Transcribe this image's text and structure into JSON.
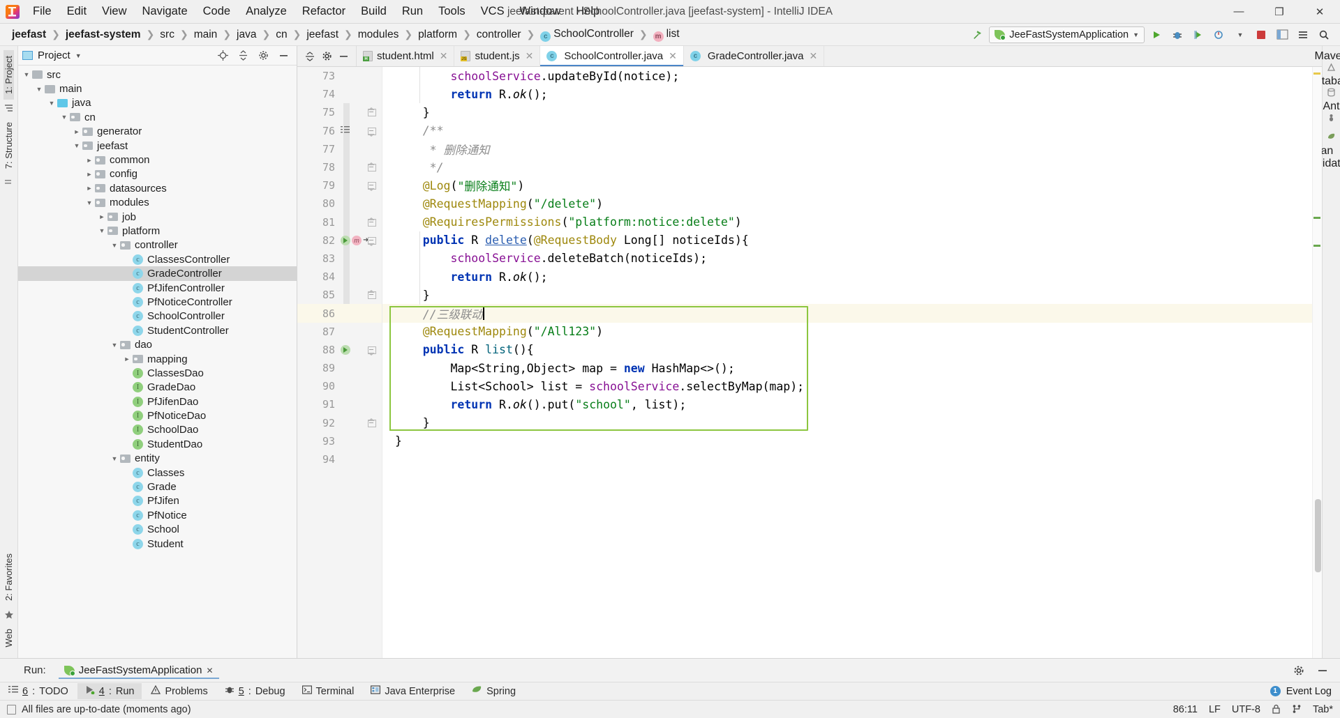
{
  "window": {
    "title": "jeefast-parent - SchoolController.java [jeefast-system] - IntelliJ IDEA",
    "minimize": "—",
    "maximize": "❐",
    "close": "✕"
  },
  "menu": [
    {
      "label": "File"
    },
    {
      "label": "Edit"
    },
    {
      "label": "View"
    },
    {
      "label": "Navigate"
    },
    {
      "label": "Code"
    },
    {
      "label": "Analyze"
    },
    {
      "label": "Refactor"
    },
    {
      "label": "Build"
    },
    {
      "label": "Run"
    },
    {
      "label": "Tools"
    },
    {
      "label": "VCS"
    },
    {
      "label": "Window"
    },
    {
      "label": "Help"
    }
  ],
  "breadcrumb": [
    {
      "label": "jeefast",
      "bold": true,
      "icon": null
    },
    {
      "label": "jeefast-system",
      "bold": true,
      "icon": null
    },
    {
      "label": "src",
      "bold": false,
      "icon": null
    },
    {
      "label": "main",
      "bold": false,
      "icon": null
    },
    {
      "label": "java",
      "bold": false,
      "icon": null
    },
    {
      "label": "cn",
      "bold": false,
      "icon": null
    },
    {
      "label": "jeefast",
      "bold": false,
      "icon": null
    },
    {
      "label": "modules",
      "bold": false,
      "icon": null
    },
    {
      "label": "platform",
      "bold": false,
      "icon": null
    },
    {
      "label": "controller",
      "bold": false,
      "icon": null
    },
    {
      "label": "SchoolController",
      "bold": false,
      "icon": "class"
    },
    {
      "label": "list",
      "bold": false,
      "icon": "method"
    }
  ],
  "toolbar": {
    "run_config": "JeeFastSystemApplication",
    "build_icon": "hammer-icon",
    "run_icon": "run-icon",
    "debug_icon": "debug-icon",
    "coverage_icon": "coverage-icon",
    "profile_icon": "profile-icon",
    "stop_icon": "stop-icon",
    "layout_icon": "layout-icon",
    "settings_icon": "settings-icon",
    "search_icon": "search-icon"
  },
  "left_rail": [
    "1: Project",
    "7: Structure",
    "2: Favorites",
    "Web"
  ],
  "right_rail": [
    "Maven",
    "Database",
    "Ant",
    "Bean Validation"
  ],
  "project_panel": {
    "title": "Project",
    "locate_icon": "locate-icon",
    "collapse_icon": "collapse-all-icon",
    "settings_icon": "gear-icon",
    "hide_icon": "hide-icon",
    "tree": [
      {
        "label": "src",
        "depth": 1,
        "arrow": "down",
        "type": "folder-src"
      },
      {
        "label": "main",
        "depth": 2,
        "arrow": "down",
        "type": "folder-src"
      },
      {
        "label": "java",
        "depth": 3,
        "arrow": "down",
        "type": "folder-blue"
      },
      {
        "label": "cn",
        "depth": 4,
        "arrow": "down",
        "type": "folder-pkg"
      },
      {
        "label": "generator",
        "depth": 5,
        "arrow": "right",
        "type": "folder-pkg"
      },
      {
        "label": "jeefast",
        "depth": 5,
        "arrow": "down",
        "type": "folder-pkg"
      },
      {
        "label": "common",
        "depth": 6,
        "arrow": "right",
        "type": "folder-pkg"
      },
      {
        "label": "config",
        "depth": 6,
        "arrow": "right",
        "type": "folder-pkg"
      },
      {
        "label": "datasources",
        "depth": 6,
        "arrow": "right",
        "type": "folder-pkg"
      },
      {
        "label": "modules",
        "depth": 6,
        "arrow": "down",
        "type": "folder-pkg"
      },
      {
        "label": "job",
        "depth": 7,
        "arrow": "right",
        "type": "folder-pkg"
      },
      {
        "label": "platform",
        "depth": 7,
        "arrow": "down",
        "type": "folder-pkg"
      },
      {
        "label": "controller",
        "depth": 8,
        "arrow": "down",
        "type": "folder-pkg"
      },
      {
        "label": "ClassesController",
        "depth": 9,
        "arrow": "none",
        "type": "class"
      },
      {
        "label": "GradeController",
        "depth": 9,
        "arrow": "none",
        "type": "class",
        "selected": true
      },
      {
        "label": "PfJifenController",
        "depth": 9,
        "arrow": "none",
        "type": "class"
      },
      {
        "label": "PfNoticeController",
        "depth": 9,
        "arrow": "none",
        "type": "class"
      },
      {
        "label": "SchoolController",
        "depth": 9,
        "arrow": "none",
        "type": "class"
      },
      {
        "label": "StudentController",
        "depth": 9,
        "arrow": "none",
        "type": "class"
      },
      {
        "label": "dao",
        "depth": 8,
        "arrow": "down",
        "type": "folder-pkg"
      },
      {
        "label": "mapping",
        "depth": 9,
        "arrow": "right",
        "type": "folder-pkg"
      },
      {
        "label": "ClassesDao",
        "depth": 9,
        "arrow": "none",
        "type": "interface"
      },
      {
        "label": "GradeDao",
        "depth": 9,
        "arrow": "none",
        "type": "interface"
      },
      {
        "label": "PfJifenDao",
        "depth": 9,
        "arrow": "none",
        "type": "interface"
      },
      {
        "label": "PfNoticeDao",
        "depth": 9,
        "arrow": "none",
        "type": "interface"
      },
      {
        "label": "SchoolDao",
        "depth": 9,
        "arrow": "none",
        "type": "interface"
      },
      {
        "label": "StudentDao",
        "depth": 9,
        "arrow": "none",
        "type": "interface"
      },
      {
        "label": "entity",
        "depth": 8,
        "arrow": "down",
        "type": "folder-pkg"
      },
      {
        "label": "Classes",
        "depth": 9,
        "arrow": "none",
        "type": "class"
      },
      {
        "label": "Grade",
        "depth": 9,
        "arrow": "none",
        "type": "class"
      },
      {
        "label": "PfJifen",
        "depth": 9,
        "arrow": "none",
        "type": "class"
      },
      {
        "label": "PfNotice",
        "depth": 9,
        "arrow": "none",
        "type": "class"
      },
      {
        "label": "School",
        "depth": 9,
        "arrow": "none",
        "type": "class"
      },
      {
        "label": "Student",
        "depth": 9,
        "arrow": "none",
        "type": "class"
      }
    ]
  },
  "tabs": [
    {
      "label": "student.html",
      "icon": "html-file-icon",
      "active": false
    },
    {
      "label": "student.js",
      "icon": "js-file-icon",
      "active": false
    },
    {
      "label": "SchoolController.java",
      "icon": "java-class-icon",
      "active": true
    },
    {
      "label": "GradeController.java",
      "icon": "java-class-icon",
      "active": false
    }
  ],
  "editor": {
    "first_line": 73,
    "lines": [
      {
        "n": 73,
        "segments": [
          {
            "t": "        ",
            "c": "def"
          },
          {
            "t": "schoolService",
            "c": "fld"
          },
          {
            "t": ".updateById(notice);",
            "c": "def"
          }
        ],
        "fold": null,
        "marks": []
      },
      {
        "n": 74,
        "segments": [
          {
            "t": "        ",
            "c": "def"
          },
          {
            "t": "return",
            "c": "kw"
          },
          {
            "t": " R.",
            "c": "def"
          },
          {
            "t": "ok",
            "c": "mth-i"
          },
          {
            "t": "();",
            "c": "def"
          }
        ],
        "fold": null,
        "marks": []
      },
      {
        "n": 75,
        "segments": [
          {
            "t": "    }",
            "c": "def"
          }
        ],
        "fold": "up",
        "marks": []
      },
      {
        "n": 76,
        "segments": [
          {
            "t": "    /**",
            "c": "cmt"
          }
        ],
        "fold": "down",
        "marks": [
          "javadoc"
        ]
      },
      {
        "n": 77,
        "segments": [
          {
            "t": "     * 删除通知",
            "c": "cmt"
          }
        ],
        "fold": null,
        "marks": []
      },
      {
        "n": 78,
        "segments": [
          {
            "t": "     */",
            "c": "cmt"
          }
        ],
        "fold": "up",
        "marks": []
      },
      {
        "n": 79,
        "segments": [
          {
            "t": "    ",
            "c": "def"
          },
          {
            "t": "@Log",
            "c": "ann"
          },
          {
            "t": "(",
            "c": "def"
          },
          {
            "t": "\"删除通知\"",
            "c": "str"
          },
          {
            "t": ")",
            "c": "def"
          }
        ],
        "fold": "down",
        "marks": []
      },
      {
        "n": 80,
        "segments": [
          {
            "t": "    ",
            "c": "def"
          },
          {
            "t": "@RequestMapping",
            "c": "ann"
          },
          {
            "t": "(",
            "c": "def"
          },
          {
            "t": "\"/delete\"",
            "c": "str"
          },
          {
            "t": ")",
            "c": "def"
          }
        ],
        "fold": null,
        "marks": []
      },
      {
        "n": 81,
        "segments": [
          {
            "t": "    ",
            "c": "def"
          },
          {
            "t": "@RequiresPermissions",
            "c": "ann"
          },
          {
            "t": "(",
            "c": "def"
          },
          {
            "t": "\"platform:notice:delete\"",
            "c": "str"
          },
          {
            "t": ")",
            "c": "def"
          }
        ],
        "fold": "up",
        "marks": []
      },
      {
        "n": 82,
        "segments": [
          {
            "t": "    ",
            "c": "def"
          },
          {
            "t": "public",
            "c": "kw"
          },
          {
            "t": " R ",
            "c": "def"
          },
          {
            "t": "delete",
            "c": "ul"
          },
          {
            "t": "(",
            "c": "def"
          },
          {
            "t": "@RequestBody",
            "c": "ann"
          },
          {
            "t": " Long[] noticeIds){",
            "c": "def"
          }
        ],
        "fold": "down",
        "marks": [
          "run",
          "method"
        ]
      },
      {
        "n": 83,
        "segments": [
          {
            "t": "        ",
            "c": "def"
          },
          {
            "t": "schoolService",
            "c": "fld"
          },
          {
            "t": ".deleteBatch(noticeIds);",
            "c": "def"
          }
        ],
        "fold": null,
        "marks": []
      },
      {
        "n": 84,
        "segments": [
          {
            "t": "        ",
            "c": "def"
          },
          {
            "t": "return",
            "c": "kw"
          },
          {
            "t": " R.",
            "c": "def"
          },
          {
            "t": "ok",
            "c": "mth-i"
          },
          {
            "t": "();",
            "c": "def"
          }
        ],
        "fold": null,
        "marks": []
      },
      {
        "n": 85,
        "segments": [
          {
            "t": "    }",
            "c": "def"
          }
        ],
        "fold": "up",
        "marks": []
      },
      {
        "n": 86,
        "segments": [
          {
            "t": "    //三级联动",
            "c": "cmt"
          }
        ],
        "fold": null,
        "marks": [],
        "highlight": true,
        "caret": true
      },
      {
        "n": 87,
        "segments": [
          {
            "t": "    ",
            "c": "def"
          },
          {
            "t": "@RequestMapping",
            "c": "ann"
          },
          {
            "t": "(",
            "c": "def"
          },
          {
            "t": "\"/All123\"",
            "c": "str"
          },
          {
            "t": ")",
            "c": "def"
          }
        ],
        "fold": null,
        "marks": []
      },
      {
        "n": 88,
        "segments": [
          {
            "t": "    ",
            "c": "def"
          },
          {
            "t": "public",
            "c": "kw"
          },
          {
            "t": " R ",
            "c": "def"
          },
          {
            "t": "list",
            "c": "mth"
          },
          {
            "t": "(){",
            "c": "def"
          }
        ],
        "fold": "down",
        "marks": [
          "run"
        ]
      },
      {
        "n": 89,
        "segments": [
          {
            "t": "        Map<String,Object> map = ",
            "c": "def"
          },
          {
            "t": "new",
            "c": "kw"
          },
          {
            "t": " HashMap<>();",
            "c": "def"
          }
        ],
        "fold": null,
        "marks": []
      },
      {
        "n": 90,
        "segments": [
          {
            "t": "        List<School> list = ",
            "c": "def"
          },
          {
            "t": "schoolService",
            "c": "fld"
          },
          {
            "t": ".selectByMap(map);",
            "c": "def"
          }
        ],
        "fold": null,
        "marks": []
      },
      {
        "n": 91,
        "segments": [
          {
            "t": "        ",
            "c": "def"
          },
          {
            "t": "return",
            "c": "kw"
          },
          {
            "t": " R.",
            "c": "def"
          },
          {
            "t": "ok",
            "c": "mth-i"
          },
          {
            "t": "().put(",
            "c": "def"
          },
          {
            "t": "\"school\"",
            "c": "str"
          },
          {
            "t": ", list);",
            "c": "def"
          }
        ],
        "fold": null,
        "marks": []
      },
      {
        "n": 92,
        "segments": [
          {
            "t": "    }",
            "c": "def"
          }
        ],
        "fold": "up",
        "marks": []
      },
      {
        "n": 93,
        "segments": [
          {
            "t": "}",
            "c": "def"
          }
        ],
        "fold": null,
        "marks": []
      },
      {
        "n": 94,
        "segments": [],
        "fold": null,
        "marks": []
      }
    ]
  },
  "run_panel": {
    "label": "Run:",
    "tab": "JeeFastSystemApplication",
    "close_icon": "close-icon",
    "settings_icon": "gear-icon",
    "hide_icon": "hide-icon"
  },
  "tool_windows": [
    {
      "num": "6",
      "label": "TODO",
      "icon": "todo-icon",
      "selected": false
    },
    {
      "num": "4",
      "label": "Run",
      "icon": "run-icon",
      "selected": true
    },
    {
      "num": "",
      "label": "Problems",
      "icon": "warning-icon",
      "selected": false
    },
    {
      "num": "5",
      "label": "Debug",
      "icon": "debug-icon",
      "selected": false
    },
    {
      "num": "",
      "label": "Terminal",
      "icon": "terminal-icon",
      "selected": false
    },
    {
      "num": "",
      "label": "Java Enterprise",
      "icon": "java-ee-icon",
      "selected": false
    },
    {
      "num": "",
      "label": "Spring",
      "icon": "spring-leaf-icon",
      "selected": false
    }
  ],
  "event_log": {
    "count": "1",
    "label": "Event Log"
  },
  "status_bar": {
    "message": "All files are up-to-date (moments ago)",
    "caret_position": "86:11",
    "line_separator": "LF",
    "encoding": "UTF-8",
    "lock_icon": "lock-icon",
    "branch_icon": "branch-icon",
    "indent": "Tab*"
  },
  "colors": {
    "accent_blue": "#4a86c8",
    "green_box": "#8cc63f",
    "highlight_line": "#fbf8ea",
    "selection": "#d4d4d4",
    "string_green": "#067d17",
    "annotation_gold": "#9e880d",
    "keyword_blue": "#0033b3",
    "field_purple": "#871094"
  }
}
